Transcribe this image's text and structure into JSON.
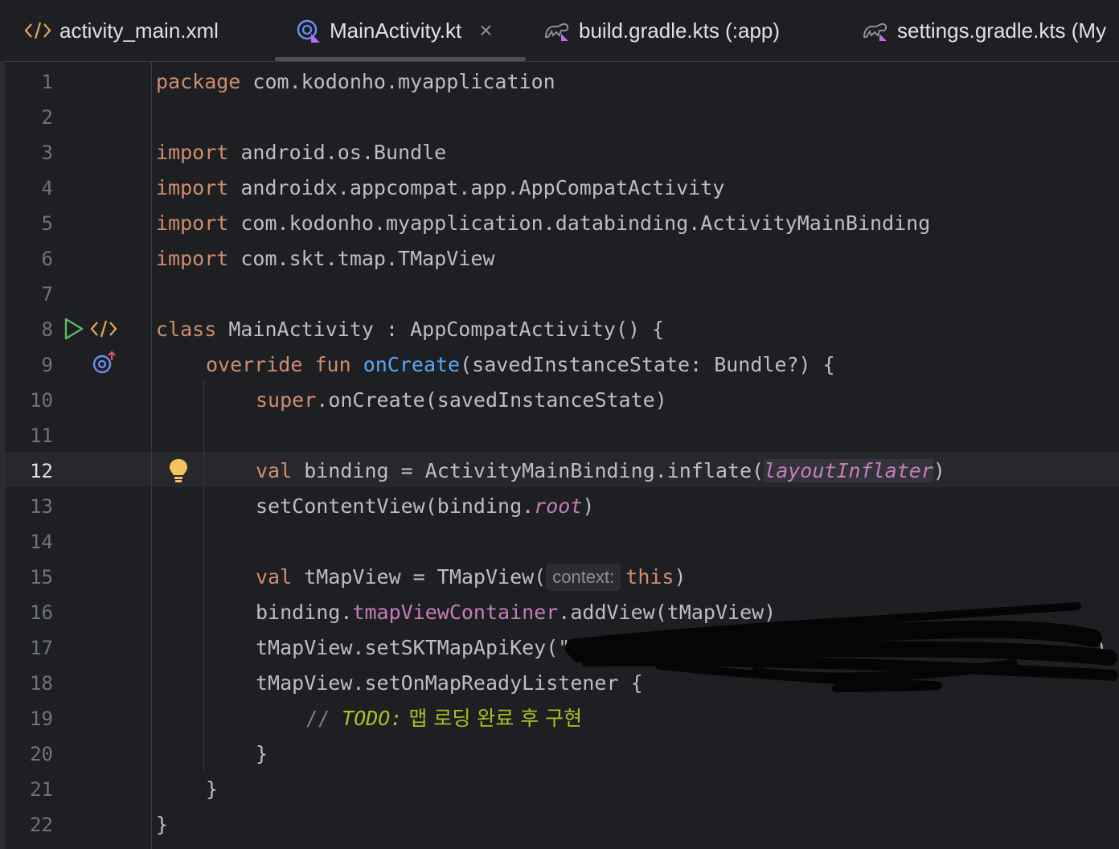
{
  "tabs": [
    {
      "label": "activity_main.xml",
      "icon": "xml-tag-icon"
    },
    {
      "label": "MainActivity.kt",
      "icon": "kotlin-class-icon",
      "active": true
    },
    {
      "label": "build.gradle.kts (:app)",
      "icon": "gradle-icon"
    },
    {
      "label": "settings.gradle.kts (My",
      "icon": "gradle-icon"
    }
  ],
  "close_glyph": "×",
  "lines": {
    "n1": "1",
    "n2": "2",
    "n3": "3",
    "n4": "4",
    "n5": "5",
    "n6": "6",
    "n7": "7",
    "n8": "8",
    "n9": "9",
    "n10": "10",
    "n11": "11",
    "n12": "12",
    "n13": "13",
    "n14": "14",
    "n15": "15",
    "n16": "16",
    "n17": "17",
    "n18": "18",
    "n19": "19",
    "n20": "20",
    "n21": "21",
    "n22": "22"
  },
  "code": {
    "l1_kw": "package",
    "l1_rest": " com.kodonho.myapplication",
    "l3_kw": "import",
    "l3_rest": " android.os.Bundle",
    "l4_kw": "import",
    "l4_rest": " androidx.appcompat.app.AppCompatActivity",
    "l5_kw": "import",
    "l5_rest": " com.kodonho.myapplication.databinding.ActivityMainBinding",
    "l6_kw": "import",
    "l6_rest": " com.skt.tmap.TMapView",
    "l8_kw": "class",
    "l8_rest": " MainActivity : AppCompatActivity() {",
    "l9_kw1": "override",
    "l9_kw2": "fun",
    "l9_fn": "onCreate",
    "l9_rest": "(savedInstanceState: Bundle?) {",
    "l10_kw": "super",
    "l10_rest": ".onCreate(savedInstanceState)",
    "l12_kw": "val",
    "l12_mid": " binding = ActivityMainBinding.inflate(",
    "l12_prop": "layoutInflater",
    "l12_end": ")",
    "l13_a": "setContentView(binding.",
    "l13_prop": "root",
    "l13_end": ")",
    "l15_kw": "val",
    "l15_mid": " tMapView = TMapView(",
    "l15_hint": "context:",
    "l15_this": "this",
    "l15_end": ")",
    "l16_a": "binding.",
    "l16_prop": "tmapViewContainer",
    "l16_end": ".addView(tMapView)",
    "l17_a": "tMapView.setSKTMapApiKey(\"",
    "l17_end": ")",
    "l18_a": "tMapView.setOnMapReadyListener {",
    "l19_cm": "// ",
    "l19_todo": "TODO:",
    "l19_text": " 맵 로딩 완료 후 구현",
    "l20": "}",
    "l21": "}",
    "l22": "}"
  },
  "colors": {
    "background": "#1e1f22",
    "keyword": "#cf8e6d",
    "function": "#56a8f5",
    "property": "#c77dbb",
    "todo": "#a8c023",
    "comment": "#7a7e85"
  }
}
